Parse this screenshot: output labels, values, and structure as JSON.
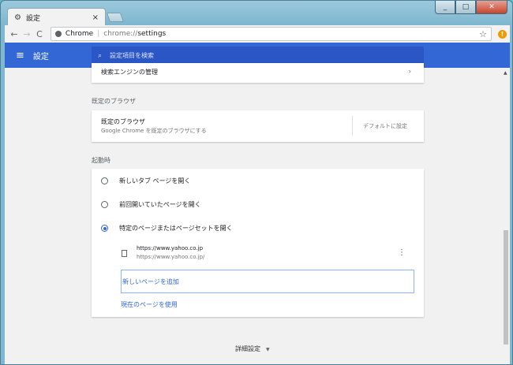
{
  "window": {
    "tab_title": "設定",
    "tab_close": "×"
  },
  "toolbar": {
    "back": "←",
    "forward": "→",
    "reload": "C",
    "omnibox_label": "Chrome",
    "omnibox_sep": "|",
    "url_scheme": "chrome://",
    "url_path": "settings",
    "star": "☆",
    "alert": "!"
  },
  "header": {
    "menu_glyph": "≡",
    "title": "設定",
    "search_placeholder": "設定項目を検索",
    "search_glyph": "⌕"
  },
  "sections": {
    "search_engine_row": "検索エンジンの管理",
    "default_browser": {
      "label": "既定のブラウザ",
      "title": "既定のブラウザ",
      "subtitle": "Google Chrome を既定のブラウザにする",
      "button": "デフォルトに設定"
    },
    "startup": {
      "label": "起動時",
      "options": [
        {
          "label": "新しいタブ ページを開く",
          "selected": false
        },
        {
          "label": "前回開いていたページを開く",
          "selected": false
        },
        {
          "label": "特定のページまたはページセットを開く",
          "selected": true
        }
      ],
      "page_title": "https://www.yahoo.co.jp",
      "page_url": "https://www.yahoo.co.jp/",
      "add_page": "新しいページを追加",
      "use_current": "現在のページを使用"
    }
  },
  "advanced": {
    "label": "詳細設定",
    "caret": "▼"
  },
  "colors": {
    "header": "#3367d6",
    "accent": "#3367d6"
  }
}
